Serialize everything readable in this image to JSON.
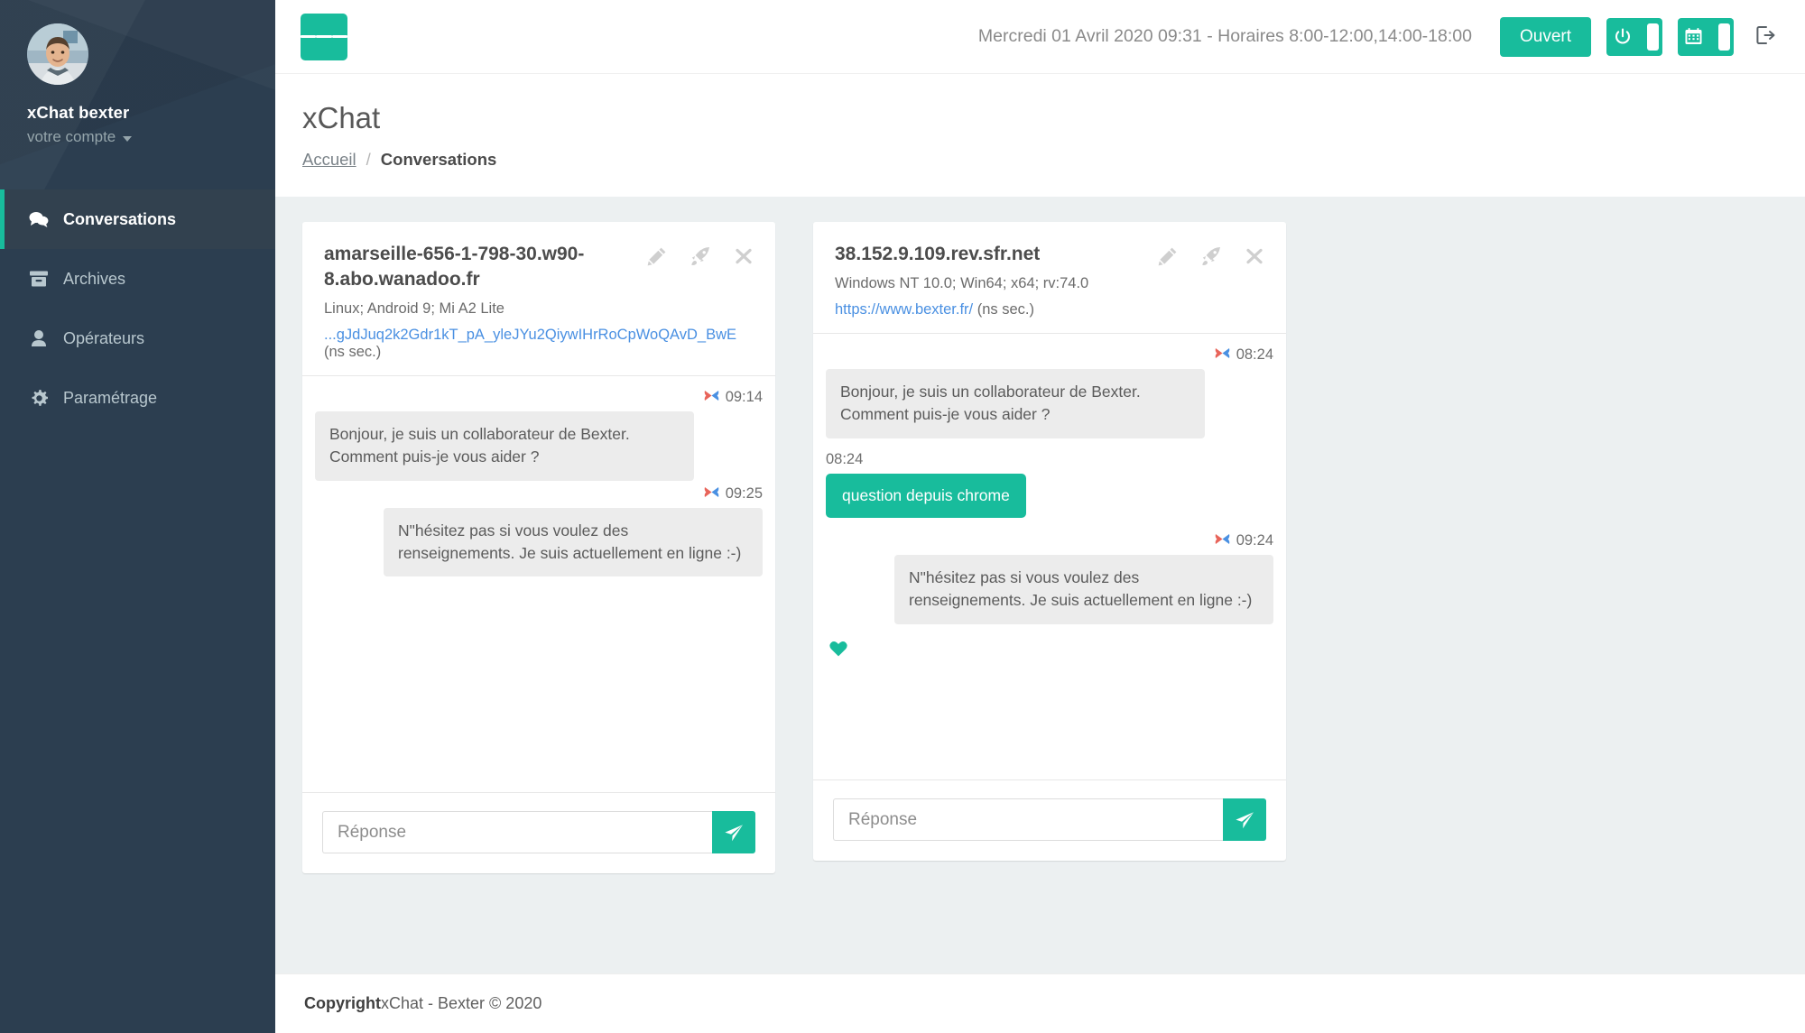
{
  "sidebar": {
    "profile": {
      "name": "xChat bexter",
      "account_label": "votre compte",
      "avatar_icon": "user-photo-avatar"
    },
    "items": [
      {
        "label": "Conversations",
        "icon": "chat-bubbles-icon",
        "active": true
      },
      {
        "label": "Archives",
        "icon": "archive-box-icon",
        "active": false
      },
      {
        "label": "Opérateurs",
        "icon": "user-icon",
        "active": false
      },
      {
        "label": "Paramétrage",
        "icon": "gear-icon",
        "active": false
      }
    ]
  },
  "topbar": {
    "menu_toggle_icon": "hamburger-icon",
    "clock": "Mercredi 01 Avril 2020 09:31 - Horaires 8:00-12:00,14:00-18:00",
    "status_button": "Ouvert",
    "power_toggle_icon": "power-icon",
    "calendar_toggle_icon": "calendar-icon",
    "logout_icon": "logout-icon",
    "accent_color": "#18bc9c"
  },
  "page": {
    "title": "xChat",
    "breadcrumb": {
      "home": "Accueil",
      "separator": "/",
      "current": "Conversations"
    }
  },
  "conversations": [
    {
      "title": "amarseille-656-1-798-30.w90-8.abo.wanadoo.fr",
      "user_agent": "Linux; Android 9; Mi A2 Lite",
      "link": "...gJdJuq2k2Gdr1kT_pA_yleJYu2QiywIHrRoCpWoQAvD_BwE",
      "link_suffix": "(ns sec.)",
      "actions": [
        "pencil-icon",
        "rocket-icon",
        "close-icon"
      ],
      "messages": [
        {
          "time": "09:14",
          "align": "left",
          "style": "grey",
          "text": "Bonjour, je suis un collaborateur de Bexter. Comment puis-je vous aider ?"
        },
        {
          "time": "09:25",
          "align": "right",
          "style": "grey",
          "text": "N\"hésitez pas si vous voulez des renseignements. Je suis actuellement en ligne :-)"
        }
      ],
      "has_heart": false,
      "reply_placeholder": "Réponse",
      "send_icon": "paper-plane-icon"
    },
    {
      "title": "38.152.9.109.rev.sfr.net",
      "user_agent": "Windows NT 10.0; Win64; x64; rv:74.0",
      "link": "https://www.bexter.fr/",
      "link_suffix": "(ns sec.)",
      "actions": [
        "pencil-icon",
        "rocket-icon",
        "close-icon"
      ],
      "messages": [
        {
          "time": "08:24",
          "align": "left",
          "style": "grey",
          "text": "Bonjour, je suis un collaborateur de Bexter. Comment puis-je vous aider ?"
        },
        {
          "time": "08:24",
          "align": "left",
          "style": "green",
          "text": "question depuis chrome"
        },
        {
          "time": "09:24",
          "align": "right",
          "style": "grey",
          "text": "N\"hésitez pas si vous voulez des renseignements. Je suis actuellement en ligne :-)"
        }
      ],
      "has_heart": true,
      "heart_icon": "heart-icon",
      "reply_placeholder": "Réponse",
      "send_icon": "paper-plane-icon"
    }
  ],
  "footer": {
    "bold": "Copyright",
    "text": " xChat - Bexter © 2020"
  }
}
